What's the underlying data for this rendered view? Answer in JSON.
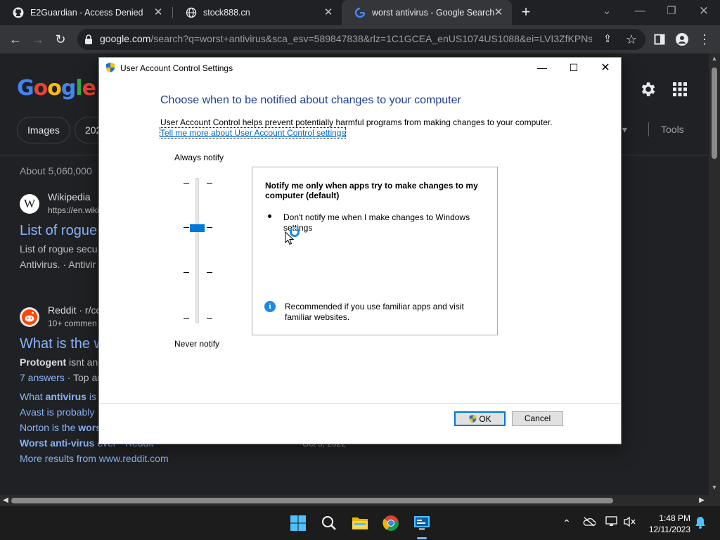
{
  "tabs": [
    {
      "title": "E2Guardian - Access Denied",
      "icon": "github-icon"
    },
    {
      "title": "stock888.cn",
      "icon": "globe-icon"
    },
    {
      "title": "worst antivirus - Google Search",
      "icon": "google-icon",
      "active": true
    }
  ],
  "toolbar": {
    "url_host": "google.com",
    "url_rest": "/search?q=worst+antivirus&sca_esv=589847838&rlz=1C1GCEA_enUS1074US1088&ei=LVI3ZfKPNsy..."
  },
  "google": {
    "logo": "Google",
    "chips": [
      "Images",
      "202"
    ],
    "nav_more": "s",
    "tools": "Tools",
    "about": "About 5,060,000",
    "results": [
      {
        "site": "Wikipedia",
        "url": "https://en.wiki",
        "title": "List of rogue",
        "snippet1": "List of rogue secu",
        "snippet2": "Antivirus. · Antivir"
      },
      {
        "site": "Reddit · r/co",
        "url": "10+ commen",
        "title": "What is the w",
        "snippet_bold": "Protogent",
        "snippet1": " isnt an",
        "answers": "7 answers",
        "answers_rest": " · Top ar"
      }
    ],
    "sub_links": [
      {
        "pre": "What ",
        "bold": "antivirus",
        "post": " is t"
      },
      {
        "pre": "Avast is probably ",
        "bold": "",
        "post": ""
      },
      {
        "pre": "Norton is the ",
        "bold": "wors",
        "post": ""
      },
      {
        "pre": "",
        "bold": "Worst anti-virus",
        "post": " ever - Reddit"
      }
    ],
    "sub_date": "Oct 5, 2022",
    "more_results": "More results from www.reddit.com"
  },
  "dialog": {
    "title": "User Account Control Settings",
    "heading": "Choose when to be notified about changes to your computer",
    "description": "User Account Control helps prevent potentially harmful programs from making changes to your computer.",
    "learn_more": "Tell me more about User Account Control settings",
    "label_top": "Always notify",
    "label_bottom": "Never notify",
    "slider_level": 3,
    "slider_levels": 4,
    "info_heading": "Notify me only when apps try to make changes to my computer (default)",
    "bullet": "Don't notify me when I make changes to Windows settings",
    "recommendation": "Recommended if you use familiar apps and visit familiar websites.",
    "ok_label": "OK",
    "cancel_label": "Cancel"
  },
  "taskbar": {
    "time": "1:48 PM",
    "date": "12/11/2023",
    "apps": [
      "windows-start-icon",
      "search-icon",
      "file-explorer-icon",
      "chrome-icon",
      "control-panel-icon"
    ]
  },
  "colors": {
    "accent": "#0078d7",
    "heading_blue": "#1e3e93",
    "link_blue": "#8ab4f8",
    "page_bg": "#202124"
  }
}
